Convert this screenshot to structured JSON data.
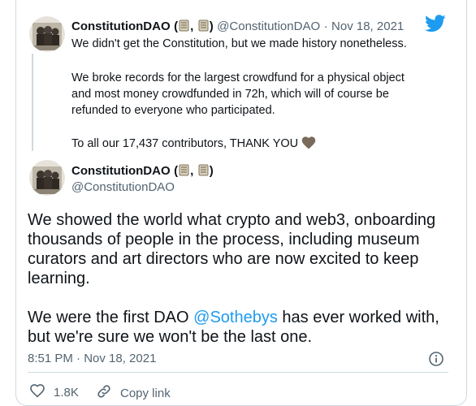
{
  "quoted_tweet": {
    "author_name": "ConstitutionDAO",
    "name_paren_open": "(",
    "name_sep": ",",
    "name_paren_close": ")",
    "handle": "@ConstitutionDAO",
    "date_sep": "·",
    "date": "Nov 18, 2021",
    "lines": [
      "We didn't get the Constitution, but we made history nonetheless.",
      "We broke records for the largest crowdfund for a physical object",
      "and most money crowdfunded in 72h, which will of course be",
      "refunded to everyone who participated.",
      "To all our 17,437 contributors, THANK YOU"
    ]
  },
  "main_tweet": {
    "author_name": "ConstitutionDAO",
    "name_paren_open": "(",
    "name_sep": ",",
    "name_paren_close": ")",
    "handle": "@ConstitutionDAO",
    "lines": [
      "We showed the world what crypto and web3, onboarding",
      "thousands of people in the process, including museum",
      "curators and art directors who are now excited to keep",
      "learning."
    ],
    "line5_before": "We were the first DAO ",
    "mention": "@Sothebys",
    "line5_after": " has ever worked with,",
    "line6": "but we're sure we won't be the last one.",
    "timestamp": "8:51 PM · Nov 18, 2021"
  },
  "actions": {
    "like_count": "1.8K",
    "copy_link_label": "Copy link"
  },
  "colors": {
    "twitter_blue": "#1d9bf0",
    "heart_brown": "#7a6a5a"
  },
  "icons": [
    "twitter-bird-icon",
    "scroll-emoji-icon",
    "brown-heart-icon",
    "info-icon",
    "heart-icon",
    "link-icon"
  ]
}
